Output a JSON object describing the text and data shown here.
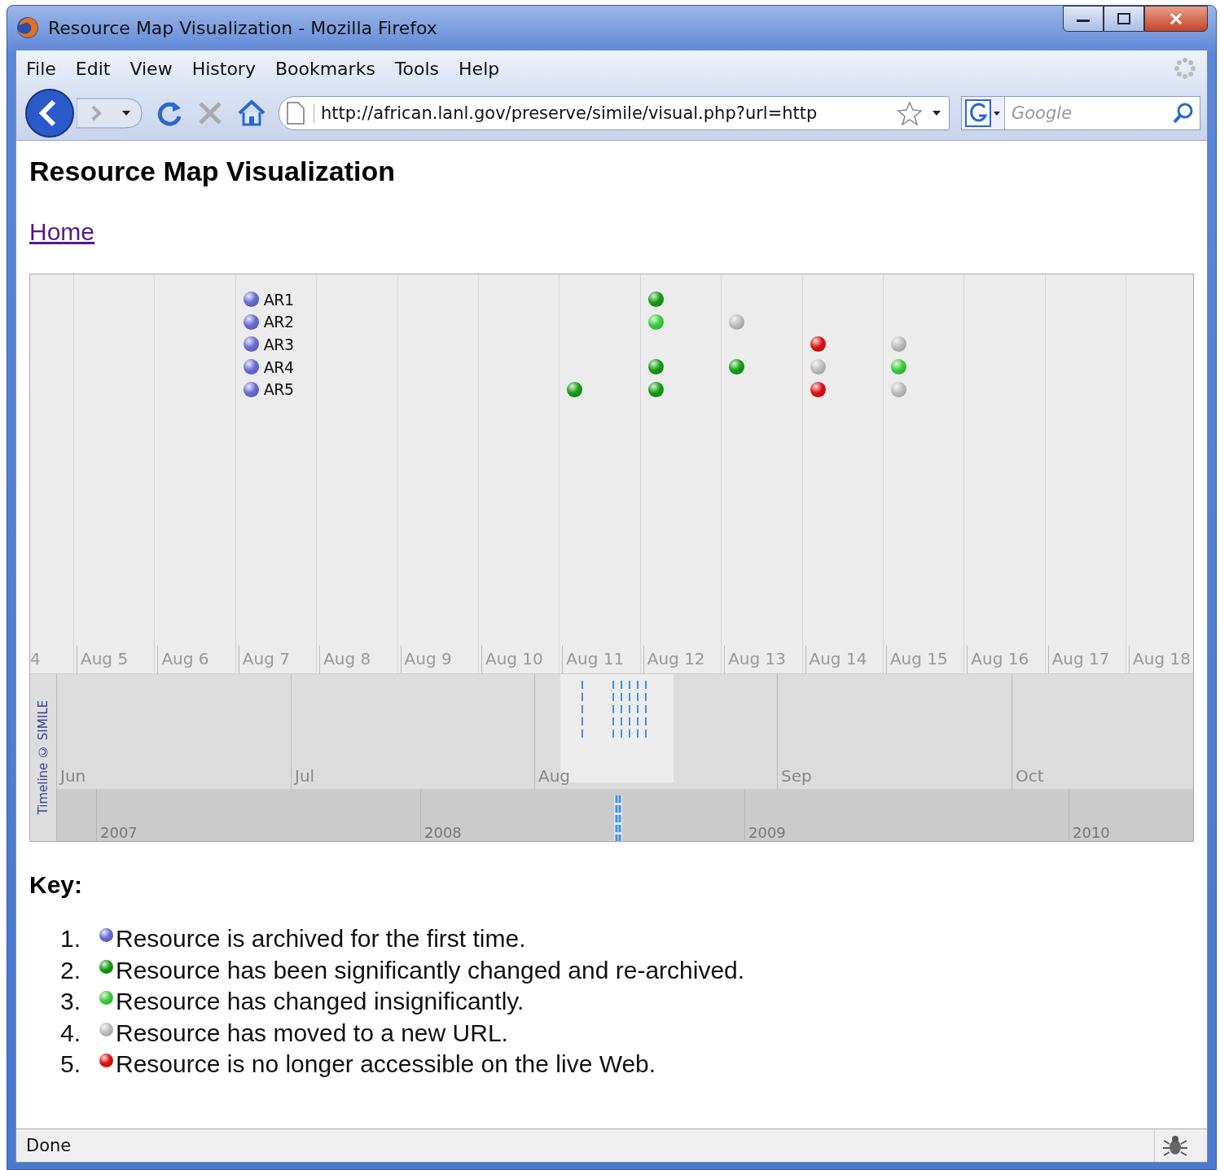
{
  "window": {
    "title": "Resource Map Visualization - Mozilla Firefox"
  },
  "menu": [
    "File",
    "Edit",
    "View",
    "History",
    "Bookmarks",
    "Tools",
    "Help"
  ],
  "toolbar": {
    "url": "http://african.lanl.gov/preserve/simile/visual.php?url=http",
    "search": {
      "placeholder": "Google"
    }
  },
  "page": {
    "heading": "Resource Map Visualization",
    "link": "Home"
  },
  "timeline": {
    "days": [
      "4",
      "Aug 5",
      "Aug 6",
      "Aug 7",
      "Aug 8",
      "Aug 9",
      "Aug 10",
      "Aug 11",
      "Aug 12",
      "Aug 13",
      "Aug 14",
      "Aug 15",
      "Aug 16",
      "Aug 17",
      "Aug 18"
    ],
    "tracks": [
      {
        "cells": [
          null,
          null,
          null,
          {
            "color": "#6a6ad8",
            "label": "AR1"
          },
          null,
          null,
          null,
          null,
          {
            "color": "#139c13"
          },
          null,
          null,
          null,
          null,
          null,
          null
        ]
      },
      {
        "cells": [
          null,
          null,
          null,
          {
            "color": "#6a6ad8",
            "label": "AR2"
          },
          null,
          null,
          null,
          null,
          {
            "color": "#3ccc3c"
          },
          {
            "color": "#bdbdbd"
          },
          null,
          null,
          null,
          null,
          null
        ]
      },
      {
        "cells": [
          null,
          null,
          null,
          {
            "color": "#6a6ad8",
            "label": "AR3"
          },
          null,
          null,
          null,
          null,
          null,
          null,
          {
            "color": "#dd1111"
          },
          {
            "color": "#bdbdbd"
          },
          null,
          null,
          null
        ]
      },
      {
        "cells": [
          null,
          null,
          null,
          {
            "color": "#6a6ad8",
            "label": "AR4"
          },
          null,
          null,
          null,
          null,
          {
            "color": "#139c13"
          },
          {
            "color": "#139c13"
          },
          {
            "color": "#bdbdbd"
          },
          {
            "color": "#3ccc3c"
          },
          null,
          null,
          null
        ]
      },
      {
        "cells": [
          null,
          null,
          null,
          {
            "color": "#6a6ad8",
            "label": "AR5"
          },
          null,
          null,
          null,
          {
            "color": "#139c13"
          },
          {
            "color": "#139c13"
          },
          null,
          {
            "color": "#dd1111"
          },
          {
            "color": "#bdbdbd"
          },
          null,
          null,
          null
        ]
      }
    ],
    "months": [
      "Jun",
      "Jul",
      "Aug",
      "Sep",
      "Oct"
    ],
    "years": [
      "2007",
      "2008",
      "2009",
      "2010"
    ],
    "credit": "Timeline © SIMILE"
  },
  "key": {
    "title": "Key:",
    "items": [
      {
        "number": "1.",
        "color": "#6a6ad8",
        "text": "Resource is archived for the first time."
      },
      {
        "number": "2.",
        "color": "#139c13",
        "text": "Resource has been significantly changed and re-archived."
      },
      {
        "number": "3.",
        "color": "#3ccc3c",
        "text": "Resource has changed insignificantly."
      },
      {
        "number": "4.",
        "color": "#bdbdbd",
        "text": "Resource has moved to a new URL."
      },
      {
        "number": "5.",
        "color": "#dd1111",
        "text": "Resource is no longer accessible on the live Web."
      }
    ]
  },
  "status_bar": {
    "text": "Done"
  }
}
